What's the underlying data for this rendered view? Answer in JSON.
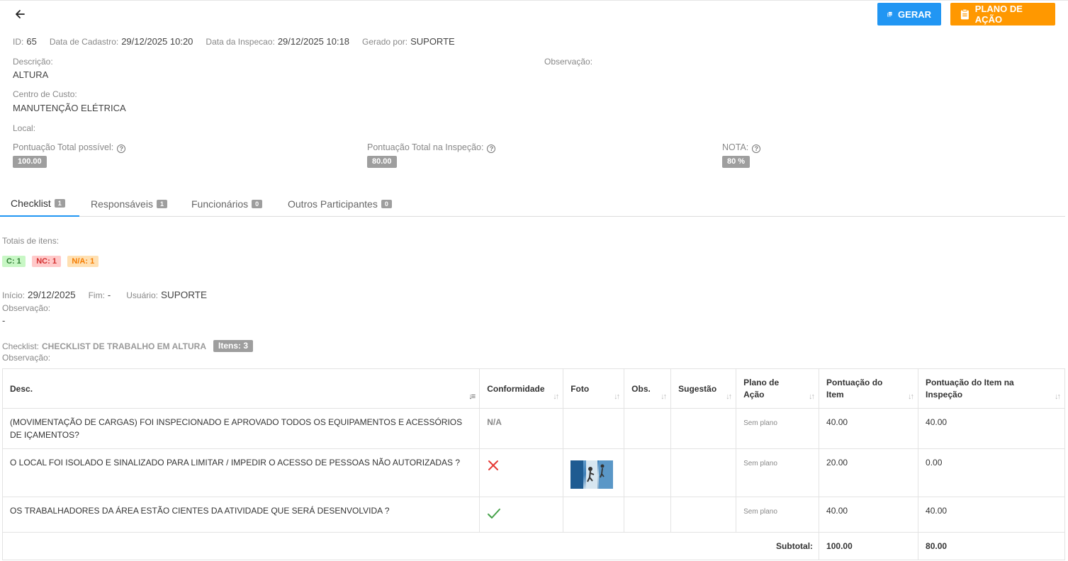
{
  "header": {
    "pdf_button": "GERAR",
    "action_plan_button": "PLANO DE AÇÃO"
  },
  "info": {
    "id_label": "ID:",
    "id_value": "65",
    "cadastro_label": "Data de Cadastro:",
    "cadastro_value": "29/12/2025 10:20",
    "inspecao_label": "Data da Inspecao:",
    "inspecao_value": "29/12/2025 10:18",
    "gerado_label": "Gerado por:",
    "gerado_value": "SUPORTE",
    "descricao_label": "Descrição:",
    "descricao_value": "ALTURA",
    "observacao_label": "Observação:",
    "centro_label": "Centro de Custo:",
    "centro_value": "MANUTENÇÃO ELÉTRICA",
    "local_label": "Local:",
    "pont_total_label": "Pontuação Total possível:",
    "pont_total_value": "100.00",
    "pont_insp_label": "Pontuação Total na Inspeção:",
    "pont_insp_value": "80.00",
    "nota_label": "NOTA:",
    "nota_value": "80 %"
  },
  "tabs": [
    {
      "label": "Checklist",
      "count": "1"
    },
    {
      "label": "Responsáveis",
      "count": "1"
    },
    {
      "label": "Funcionários",
      "count": "0"
    },
    {
      "label": "Outros Participantes",
      "count": "0"
    }
  ],
  "checklist_section": {
    "totais_label": "Totais de itens:",
    "tag_c": "C: 1",
    "tag_nc": "NC: 1",
    "tag_na": "N/A: 1",
    "inicio_label": "Início:",
    "inicio_value": "29/12/2025",
    "fim_label": "Fim:",
    "fim_value": "-",
    "usuario_label": "Usuário:",
    "usuario_value": "SUPORTE",
    "observacao_label": "Observação:",
    "observacao_value": "-",
    "checklist_label": "Checklist:",
    "checklist_value": "CHECKLIST DE TRABALHO EM ALTURA",
    "itens_badge": "Itens: 3",
    "observacao2_label": "Observação:"
  },
  "table": {
    "columns": [
      "Desc.",
      "Conformidade",
      "Foto",
      "Obs.",
      "Sugestão",
      "Plano de Ação",
      "Pontuação do Item",
      "Pontuação do Item na Inspeção"
    ],
    "rows": [
      {
        "desc": "(MOVIMENTAÇÃO DE CARGAS) FOI INSPECIONADO E APROVADO TODOS OS EQUIPAMENTOS E ACESSÓRIOS DE IÇAMENTOS?",
        "conformidade": "N/A",
        "plano": "Sem plano",
        "pont_item": "40.00",
        "pont_insp": "40.00"
      },
      {
        "desc": "O LOCAL FOI ISOLADO E SINALIZADO PARA LIMITAR / IMPEDIR O ACESSO DE PESSOAS NÃO AUTORIZADAS ?",
        "conformidade": "",
        "plano": "Sem plano",
        "pont_item": "20.00",
        "pont_insp": "0.00"
      },
      {
        "desc": "OS TRABALHADORES DA ÁREA ESTÃO CIENTES DA ATIVIDADE QUE SERÁ DESENVOLVIDA ?",
        "conformidade": "",
        "plano": "Sem plano",
        "pont_item": "40.00",
        "pont_insp": "40.00"
      }
    ],
    "subtotal_label": "Subtotal:",
    "subtotal_item": "100.00",
    "subtotal_insp": "80.00"
  }
}
